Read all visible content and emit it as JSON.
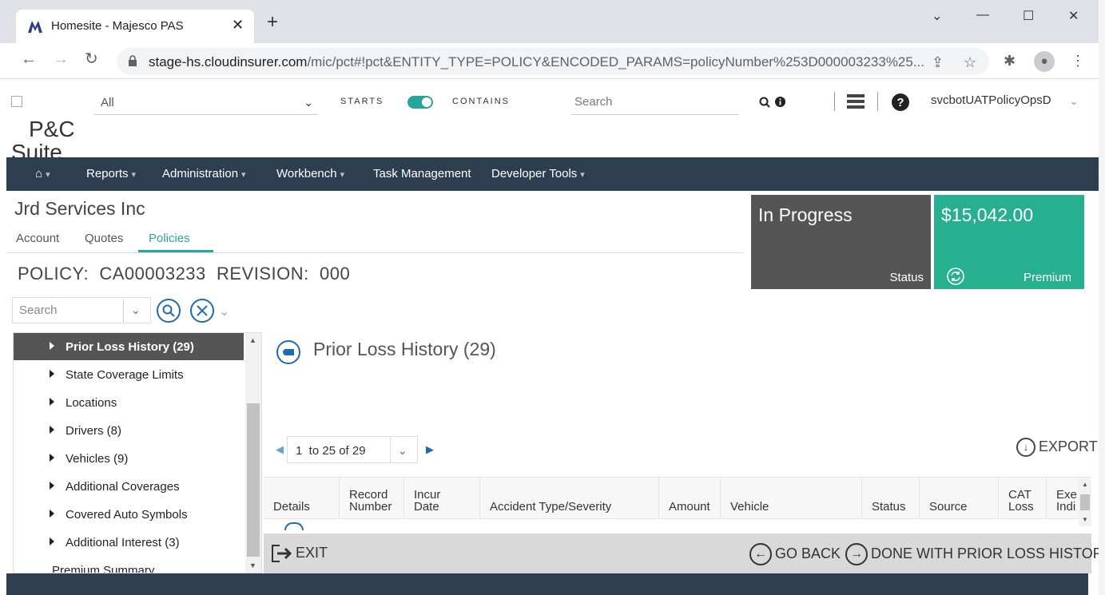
{
  "browser": {
    "tab_title": "Homesite - Majesco PAS",
    "url_domain": "stage-hs.cloudinsurer.com",
    "url_rest": "/mic/pct#!pct&ENTITY_TYPE=POLICY&ENCODED_PARAMS=policyNumber%253D000003233%25..."
  },
  "header": {
    "logo_text_line1": "P&C",
    "logo_text_line2": "Suite",
    "scope_select": "All",
    "starts_label": "STARTS",
    "contains_label": "CONTAINS",
    "search_placeholder": "Search",
    "username": "svcbotUATPolicyOpsD"
  },
  "nav": {
    "items": [
      "Reports",
      "Administration",
      "Workbench",
      "Task Management",
      "Developer Tools"
    ]
  },
  "account": {
    "name": "Jrd Services Inc",
    "tabs": [
      "Account",
      "Quotes",
      "Policies"
    ],
    "active_tab": "Policies",
    "policy_label": "POLICY:",
    "policy_number": "CA00003233",
    "revision_label": "REVISION:",
    "revision_number": "000"
  },
  "tiles": {
    "status_value": "In Progress",
    "status_label": "Status",
    "premium_value": "$15,042.00",
    "premium_label": "Premium",
    "status_color": "#555555",
    "premium_color": "#26b08f"
  },
  "sidebar": {
    "search_placeholder": "Search",
    "items": [
      "Prior Loss History (29)",
      "State Coverage Limits",
      "Locations",
      "Drivers (8)",
      "Vehicles (9)",
      "Additional Coverages",
      "Covered Auto Symbols",
      "Additional Interest (3)",
      "Premium Summary"
    ],
    "active_index": 0
  },
  "content": {
    "title": "Prior Loss History (29)",
    "pagination": "1  to 25 of 29",
    "export_label": "EXPORT",
    "columns": [
      "Details",
      "Record Number",
      "Incur Date",
      "Accident Type/Severity",
      "Amount",
      "Vehicle",
      "Status",
      "Source",
      "CAT Loss",
      "Exe Indi"
    ]
  },
  "footer": {
    "exit_label": "EXIT",
    "go_back_label": "GO BACK",
    "done_label": "DONE WITH PRIOR LOSS HISTORY"
  },
  "colors": {
    "accent": "#26a69a",
    "nav_bg": "#2c3e50",
    "link_blue": "#1f6bb0"
  }
}
